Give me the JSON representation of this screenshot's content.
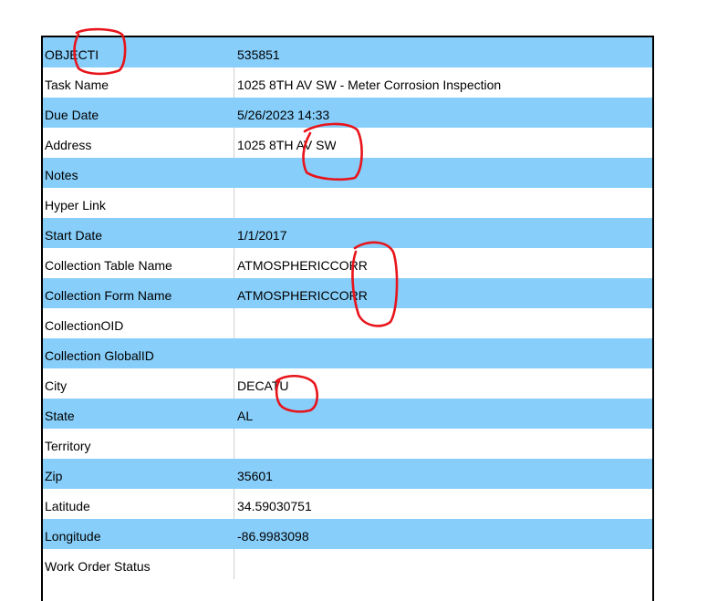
{
  "rows": [
    {
      "label": "OBJECTI",
      "value": "535851",
      "shade": "blue"
    },
    {
      "label": "Task Name",
      "value": "1025 8TH AV SW - Meter Corrosion Inspection",
      "shade": "white"
    },
    {
      "label": "Due Date",
      "value": "5/26/2023 14:33",
      "shade": "blue"
    },
    {
      "label": "Address",
      "value": "1025 8TH AV SW",
      "shade": "white"
    },
    {
      "label": "Notes",
      "value": "",
      "shade": "blue"
    },
    {
      "label": "Hyper Link",
      "value": "",
      "shade": "white"
    },
    {
      "label": "Start Date",
      "value": "1/1/2017",
      "shade": "blue"
    },
    {
      "label": "Collection Table Name",
      "value": "ATMOSPHERICCORR",
      "shade": "white"
    },
    {
      "label": "Collection Form Name",
      "value": "ATMOSPHERICCORR",
      "shade": "blue"
    },
    {
      "label": "CollectionOID",
      "value": "",
      "shade": "white"
    },
    {
      "label": "Collection GlobalID",
      "value": "",
      "shade": "blue"
    },
    {
      "label": "City",
      "value": "DECATU",
      "shade": "white"
    },
    {
      "label": "State",
      "value": "AL",
      "shade": "blue"
    },
    {
      "label": "Territory",
      "value": "",
      "shade": "white"
    },
    {
      "label": "Zip",
      "value": "35601",
      "shade": "blue"
    },
    {
      "label": "Latitude",
      "value": "34.59030751",
      "shade": "white"
    },
    {
      "label": "Longitude",
      "value": "-86.9983098",
      "shade": "blue"
    },
    {
      "label": "Work Order Status",
      "value": "",
      "shade": "white"
    }
  ],
  "colors": {
    "row_blue": "#87cefa",
    "annotation": "#e8141b"
  }
}
